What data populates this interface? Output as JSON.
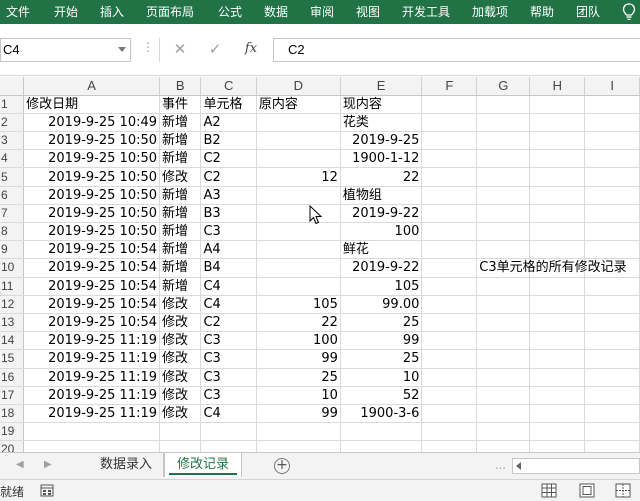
{
  "ribbon": {
    "tabs": [
      "文件",
      "开始",
      "插入",
      "页面布局",
      "公式",
      "数据",
      "审阅",
      "视图",
      "开发工具",
      "加载项",
      "帮助",
      "团队"
    ],
    "icon": "lightbulb-icon"
  },
  "formula_bar": {
    "name_box": "C4",
    "cancel_glyph": "✕",
    "enter_glyph": "✓",
    "fx_label": "fx",
    "content": "C2"
  },
  "grid": {
    "columns": [
      "A",
      "B",
      "C",
      "D",
      "E",
      "F",
      "G",
      "H",
      "I"
    ],
    "row_numbers": [
      "1",
      "2",
      "3",
      "4",
      "5",
      "6",
      "7",
      "8",
      "9",
      "10",
      "11",
      "12",
      "13",
      "14",
      "15",
      "16",
      "17",
      "18",
      "19",
      "20"
    ],
    "headers": [
      "修改日期",
      "事件",
      "单元格",
      "原内容",
      "现内容"
    ],
    "rows": [
      [
        "2019-9-25 10:49",
        "新增",
        "A2",
        "",
        "花类"
      ],
      [
        "2019-9-25 10:50",
        "新增",
        "B2",
        "",
        "2019-9-25"
      ],
      [
        "2019-9-25 10:50",
        "新增",
        "C2",
        "",
        "1900-1-12"
      ],
      [
        "2019-9-25 10:50",
        "修改",
        "C2",
        "12",
        "22"
      ],
      [
        "2019-9-25 10:50",
        "新增",
        "A3",
        "",
        "植物组"
      ],
      [
        "2019-9-25 10:50",
        "新增",
        "B3",
        "",
        "2019-9-22"
      ],
      [
        "2019-9-25 10:50",
        "新增",
        "C3",
        "",
        "100"
      ],
      [
        "2019-9-25 10:54",
        "新增",
        "A4",
        "",
        "鲜花"
      ],
      [
        "2019-9-25 10:54",
        "新增",
        "B4",
        "",
        "2019-9-22"
      ],
      [
        "2019-9-25 10:54",
        "新增",
        "C4",
        "",
        "105"
      ],
      [
        "2019-9-25 10:54",
        "修改",
        "C4",
        "105",
        "99.00"
      ],
      [
        "2019-9-25 10:54",
        "修改",
        "C2",
        "22",
        "25"
      ],
      [
        "2019-9-25 11:19",
        "修改",
        "C3",
        "100",
        "99"
      ],
      [
        "2019-9-25 11:19",
        "修改",
        "C3",
        "99",
        "25"
      ],
      [
        "2019-9-25 11:19",
        "修改",
        "C3",
        "25",
        "10"
      ],
      [
        "2019-9-25 11:19",
        "修改",
        "C3",
        "10",
        "52"
      ],
      [
        "2019-9-25 11:19",
        "修改",
        "C4",
        "99",
        "1900-3-6"
      ]
    ],
    "note_g10": "C3单元格的所有修改记录"
  },
  "sheet_tabs": {
    "tabs": [
      "数据录入",
      "修改记录"
    ],
    "active": "修改记录",
    "add_glyph": "+",
    "more_glyph": "…"
  },
  "status_bar": {
    "ready": "就绪"
  },
  "colors": {
    "ribbon": "#217346",
    "active_tab_text": "#217346",
    "header_bg": "#f3f3f3",
    "gridline": "#dadada"
  }
}
